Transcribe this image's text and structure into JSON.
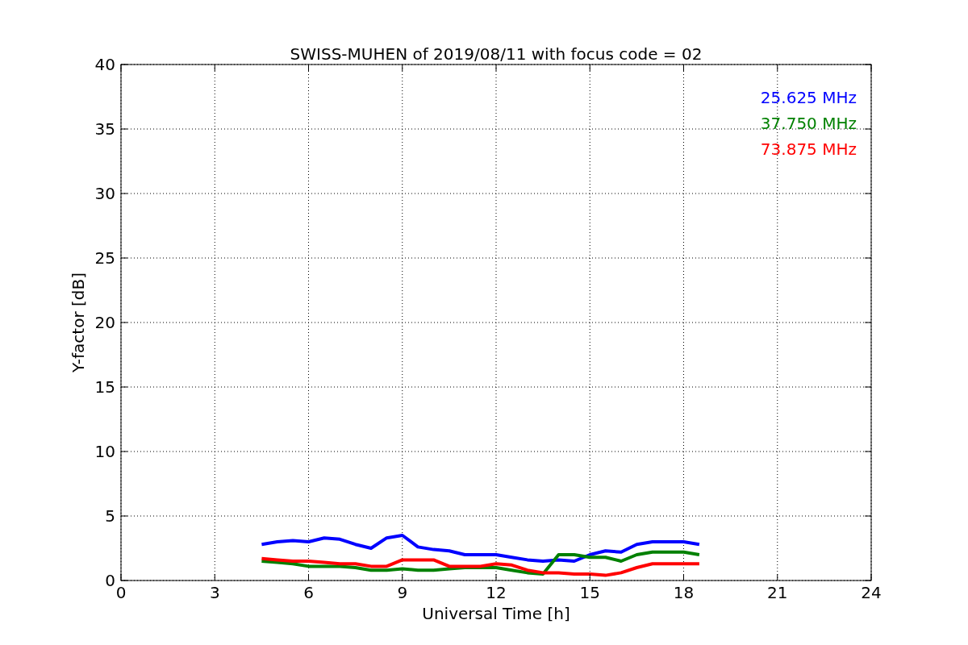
{
  "chart_data": {
    "type": "line",
    "title": "SWISS-MUHEN of 2019/08/11 with focus code = 02",
    "xlabel": "Universal Time [h]",
    "ylabel": "Y-factor [dB]",
    "x": [
      4.5,
      5,
      5.5,
      6,
      6.5,
      7,
      7.5,
      8,
      8.5,
      9,
      9.5,
      10,
      10.5,
      11,
      11.5,
      12,
      12.5,
      13,
      13.5,
      14,
      14.5,
      15,
      15.5,
      16,
      16.5,
      17,
      17.5,
      18,
      18.5
    ],
    "series": [
      {
        "name": "25.625 MHz",
        "color": "#0000ff",
        "values": [
          2.8,
          3.0,
          3.1,
          3.0,
          3.3,
          3.2,
          2.8,
          2.5,
          3.3,
          3.5,
          2.6,
          2.4,
          2.3,
          2.0,
          2.0,
          2.0,
          1.8,
          1.6,
          1.5,
          1.6,
          1.5,
          2.0,
          2.3,
          2.2,
          2.8,
          3.0,
          3.0,
          3.0,
          2.8
        ]
      },
      {
        "name": "37.750 MHz",
        "color": "#008000",
        "values": [
          1.5,
          1.4,
          1.3,
          1.1,
          1.1,
          1.1,
          1.0,
          0.8,
          0.8,
          0.9,
          0.8,
          0.8,
          0.9,
          1.0,
          1.0,
          1.0,
          0.8,
          0.6,
          0.5,
          2.0,
          2.0,
          1.8,
          1.8,
          1.5,
          2.0,
          2.2,
          2.2,
          2.2,
          2.0
        ]
      },
      {
        "name": "73.875 MHz",
        "color": "#ff0000",
        "values": [
          1.7,
          1.6,
          1.5,
          1.5,
          1.4,
          1.3,
          1.3,
          1.1,
          1.1,
          1.6,
          1.6,
          1.6,
          1.1,
          1.1,
          1.1,
          1.3,
          1.2,
          0.8,
          0.6,
          0.6,
          0.5,
          0.5,
          0.4,
          0.6,
          1.0,
          1.3,
          1.3,
          1.3,
          1.3
        ]
      }
    ],
    "grid": true,
    "xlim": [
      0,
      24
    ],
    "ylim": [
      0,
      40
    ],
    "xticks": [
      0,
      3,
      6,
      9,
      12,
      15,
      18,
      21,
      24
    ],
    "yticks": [
      0,
      5,
      10,
      15,
      20,
      25,
      30,
      35,
      40
    ]
  }
}
